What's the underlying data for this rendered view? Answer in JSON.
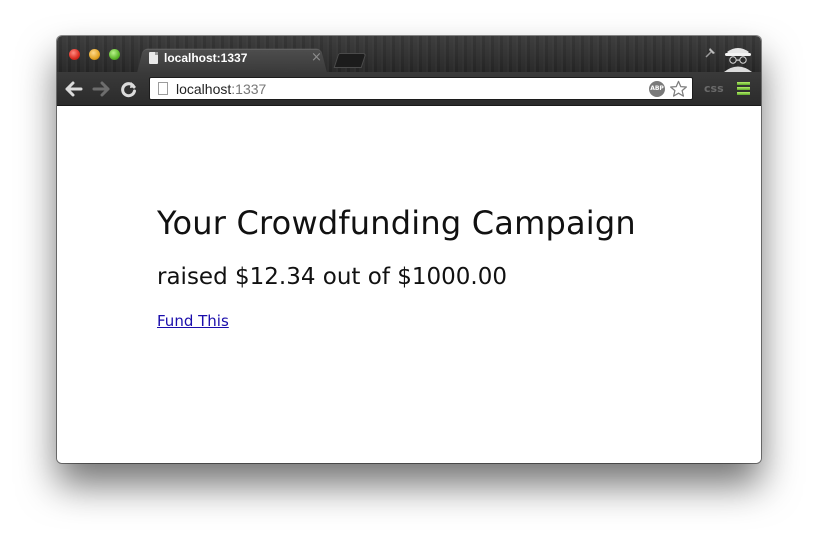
{
  "browser": {
    "tab_title": "localhost:1337",
    "tab_close_glyph": "×",
    "url_host": "localhost",
    "url_port": ":1337",
    "abp_label": "ABP",
    "css_extension_label": "css"
  },
  "page": {
    "headline": "Your Crowdfunding Campaign",
    "raised_text": "raised $12.34 out of $1000.00",
    "fund_link": "Fund This"
  },
  "colors": {
    "link": "#1a0dab",
    "menu_accent": "#7cc63a"
  },
  "icons": [
    "close-window-icon",
    "minimize-window-icon",
    "zoom-window-icon",
    "page-icon",
    "back-arrow-icon",
    "forward-arrow-icon",
    "reload-icon",
    "adblock-icon",
    "star-icon",
    "incognito-icon",
    "wrench-menu-icon"
  ]
}
